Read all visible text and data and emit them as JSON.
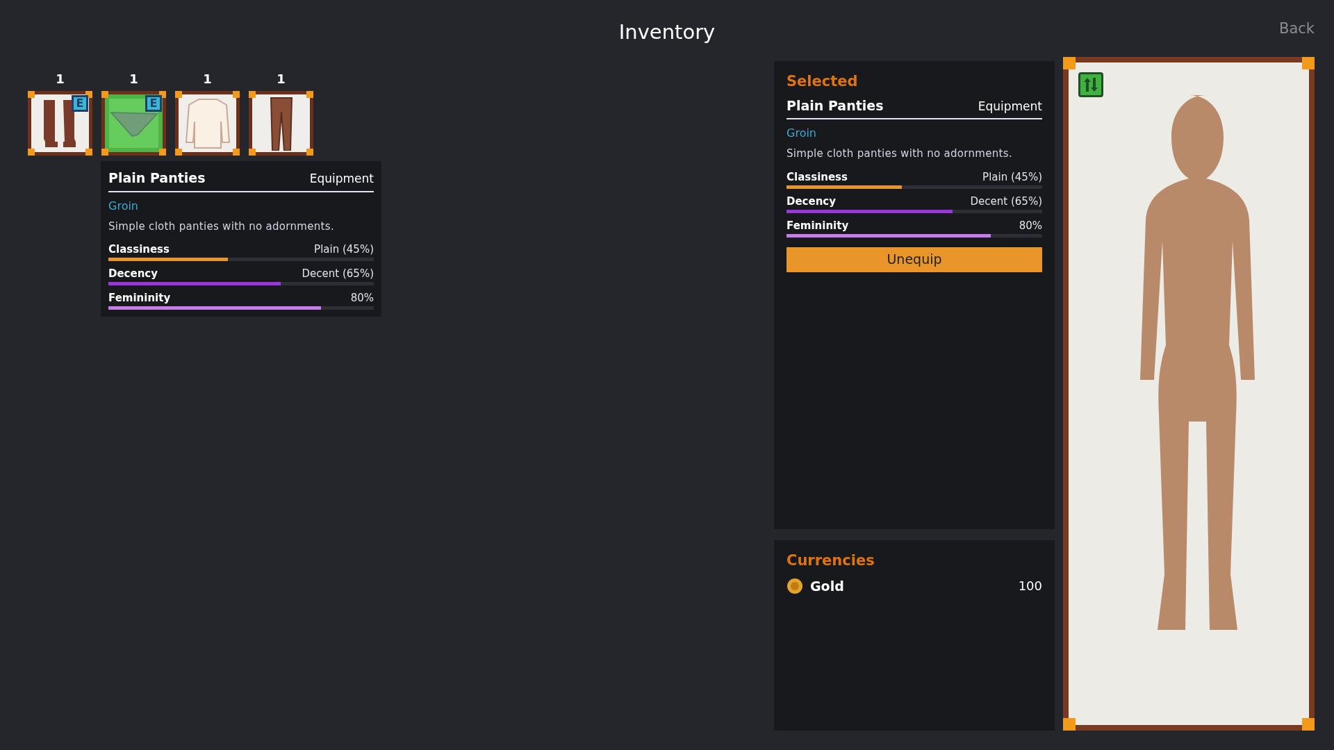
{
  "title": "Inventory",
  "back_button": "Back",
  "items": [
    {
      "kind": "boots",
      "count": "1",
      "badge": "E",
      "selected": false
    },
    {
      "kind": "panties",
      "count": "1",
      "badge": "E",
      "selected": true
    },
    {
      "kind": "shirt",
      "count": "1",
      "selected": false
    },
    {
      "kind": "pants",
      "count": "1",
      "selected": false
    }
  ],
  "tooltip": {
    "name": "Plain Panties",
    "type": "Equipment",
    "slot": "Groin",
    "description": "Simple cloth panties with no adornments.",
    "stats": [
      {
        "label": "Classiness",
        "reading": "Plain (45%)",
        "level": 0.45,
        "color": "#e8952a"
      },
      {
        "label": "Decency",
        "reading": "Decent (65%)",
        "level": 0.65,
        "color": "#9b35dc"
      },
      {
        "label": "Femininity",
        "reading": "80%",
        "level": 0.8,
        "color": "#c67de9"
      }
    ]
  },
  "selected_panel": {
    "heading": "Selected",
    "name": "Plain Panties",
    "type": "Equipment",
    "slot": "Groin",
    "description": "Simple cloth panties with no adornments.",
    "stats": [
      {
        "label": "Classiness",
        "reading": "Plain (45%)",
        "level": 0.45,
        "color": "#e8952a"
      },
      {
        "label": "Decency",
        "reading": "Decent (65%)",
        "level": 0.65,
        "color": "#9b35dc"
      },
      {
        "label": "Femininity",
        "reading": "80%",
        "level": 0.8,
        "color": "#c67de9"
      }
    ],
    "action_button": "Unequip"
  },
  "currencies": {
    "heading": "Currencies",
    "entries": [
      {
        "name": "Gold",
        "amount": "100"
      }
    ]
  }
}
